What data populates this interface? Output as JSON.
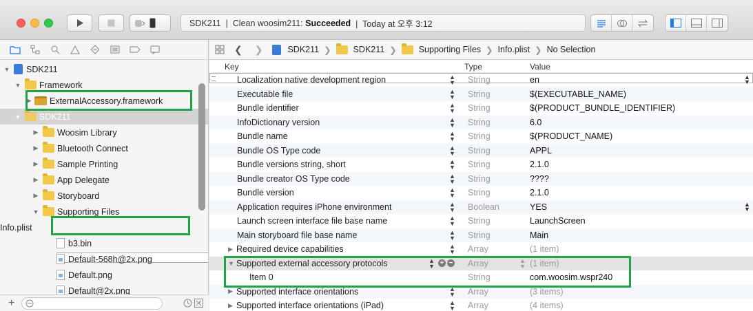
{
  "toolbar": {
    "scheme_name": "SDK211",
    "status_prefix": "SDK211  |  Clean woosim211: ",
    "status_result": "Succeeded",
    "status_time": "  |  Today at 오후 3:12",
    "run_icon": "play-icon",
    "stop_icon": "stop-icon"
  },
  "navigator": {
    "tree": [
      {
        "label": "SDK211",
        "kind": "project"
      },
      {
        "label": "Framework",
        "kind": "folder"
      },
      {
        "label": "ExternalAccessory.framework",
        "kind": "framework"
      },
      {
        "label": "SDK211",
        "kind": "folder"
      },
      {
        "label": "Woosim Library",
        "kind": "folder"
      },
      {
        "label": "Bluetooth Connect",
        "kind": "folder"
      },
      {
        "label": "Sample Printing",
        "kind": "folder"
      },
      {
        "label": "App Delegate",
        "kind": "folder"
      },
      {
        "label": "Storyboard",
        "kind": "folder"
      },
      {
        "label": "Supporting Files",
        "kind": "folder"
      },
      {
        "label": "Info.plist",
        "kind": "plist"
      },
      {
        "label": "b3.bin",
        "kind": "file"
      },
      {
        "label": "Default-568h@2x.png",
        "kind": "png"
      },
      {
        "label": "Default.png",
        "kind": "png"
      },
      {
        "label": "Default@2x.png",
        "kind": "png"
      }
    ],
    "add_label": "+"
  },
  "jumpbar": {
    "crumbs": [
      "SDK211",
      "SDK211",
      "Supporting Files",
      "Info.plist",
      "No Selection"
    ]
  },
  "columns": {
    "key": "Key",
    "type": "Type",
    "value": "Value"
  },
  "rows": [
    {
      "key": "Localization native development region",
      "type": "String",
      "value": "en"
    },
    {
      "key": "Executable file",
      "type": "String",
      "value": "$(EXECUTABLE_NAME)"
    },
    {
      "key": "Bundle identifier",
      "type": "String",
      "value": "$(PRODUCT_BUNDLE_IDENTIFIER)"
    },
    {
      "key": "InfoDictionary version",
      "type": "String",
      "value": "6.0"
    },
    {
      "key": "Bundle name",
      "type": "String",
      "value": "$(PRODUCT_NAME)"
    },
    {
      "key": "Bundle OS Type code",
      "type": "String",
      "value": "APPL"
    },
    {
      "key": "Bundle versions string, short",
      "type": "String",
      "value": "2.1.0"
    },
    {
      "key": "Bundle creator OS Type code",
      "type": "String",
      "value": "????"
    },
    {
      "key": "Bundle version",
      "type": "String",
      "value": "2.1.0"
    },
    {
      "key": "Application requires iPhone environment",
      "type": "Boolean",
      "value": "YES"
    },
    {
      "key": "Launch screen interface file base name",
      "type": "String",
      "value": "LaunchScreen"
    },
    {
      "key": "Main storyboard file base name",
      "type": "String",
      "value": "Main"
    },
    {
      "key": "Required device capabilities",
      "type": "Array",
      "value": "(1 item)"
    },
    {
      "key": "Supported external accessory protocols",
      "type": "Array",
      "value": "(1 item)"
    },
    {
      "key": "Item 0",
      "type": "String",
      "value": "com.woosim.wspr240"
    },
    {
      "key": "Supported interface orientations",
      "type": "Array",
      "value": "(3 items)"
    },
    {
      "key": "Supported interface orientations (iPad)",
      "type": "Array",
      "value": "(4 items)"
    }
  ],
  "colors": {
    "highlight_box": "#22a247",
    "accent": "#1f7af5"
  }
}
